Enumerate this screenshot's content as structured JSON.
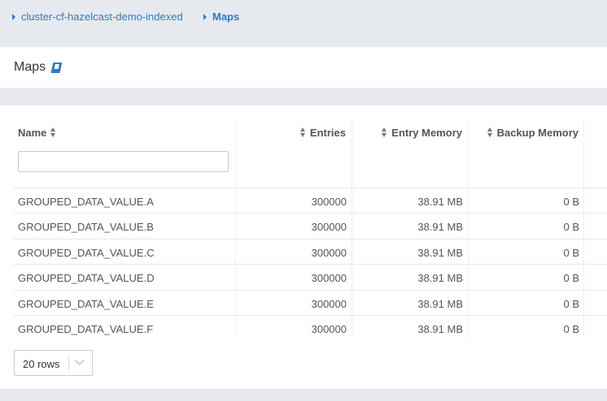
{
  "breadcrumb": {
    "items": [
      {
        "label": "cluster-cf-hazelcast-demo-indexed"
      },
      {
        "label": "Maps"
      }
    ]
  },
  "page": {
    "title": "Maps",
    "icon": "book-icon"
  },
  "table": {
    "columns": [
      "Name",
      "Entries",
      "Entry Memory",
      "Backup Memory"
    ],
    "filter": {
      "value": "",
      "placeholder": ""
    },
    "rows": [
      {
        "name": "GROUPED_DATA_VALUE.A",
        "entries": "300000",
        "entry_memory": "38.91 MB",
        "backup_memory": "0 B"
      },
      {
        "name": "GROUPED_DATA_VALUE.B",
        "entries": "300000",
        "entry_memory": "38.91 MB",
        "backup_memory": "0 B"
      },
      {
        "name": "GROUPED_DATA_VALUE.C",
        "entries": "300000",
        "entry_memory": "38.91 MB",
        "backup_memory": "0 B"
      },
      {
        "name": "GROUPED_DATA_VALUE.D",
        "entries": "300000",
        "entry_memory": "38.91 MB",
        "backup_memory": "0 B"
      },
      {
        "name": "GROUPED_DATA_VALUE.E",
        "entries": "300000",
        "entry_memory": "38.91 MB",
        "backup_memory": "0 B"
      },
      {
        "name": "GROUPED_DATA_VALUE.F",
        "entries": "300000",
        "entry_memory": "38.91 MB",
        "backup_memory": "0 B"
      }
    ]
  },
  "pagination": {
    "rows_label": "20 rows"
  },
  "colors": {
    "link": "#2f7bbf",
    "background": "#e6e9ee"
  }
}
